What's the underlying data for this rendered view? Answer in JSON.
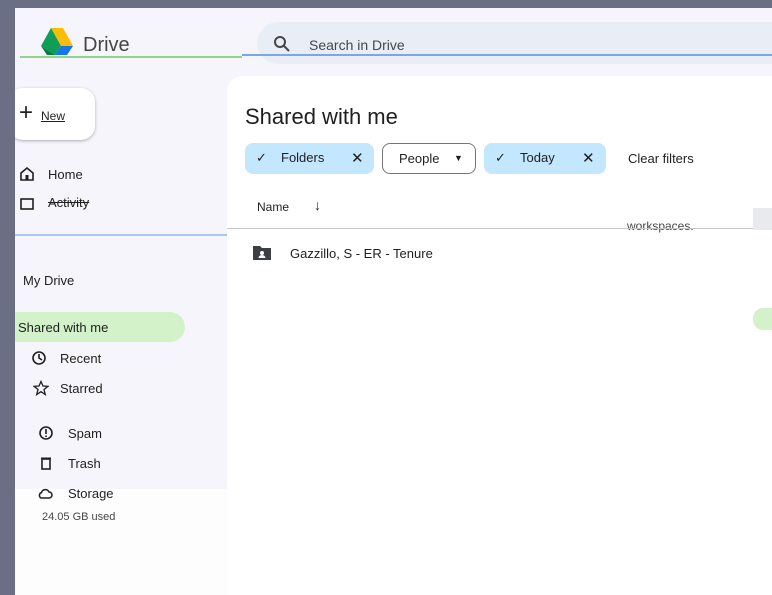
{
  "app": {
    "name": "Drive",
    "brand_color": "#1a73e8"
  },
  "search": {
    "placeholder": "Search in Drive"
  },
  "sidebar": {
    "new_label": "New",
    "items": [
      {
        "label": "Home",
        "icon": "home-icon"
      },
      {
        "label": "Activity",
        "icon": "activity-icon"
      },
      {
        "label": "My Drive",
        "icon": "my-drive-icon"
      },
      {
        "label": "Shared with me",
        "icon": "shared-icon",
        "active": true
      },
      {
        "label": "Recent",
        "icon": "clock-icon"
      },
      {
        "label": "Starred",
        "icon": "star-icon"
      },
      {
        "label": "Spam",
        "icon": "spam-icon"
      },
      {
        "label": "Trash",
        "icon": "trash-icon"
      },
      {
        "label": "Storage",
        "icon": "cloud-icon"
      }
    ],
    "storage_used": "24.05 GB used"
  },
  "main": {
    "title": "Shared with me",
    "filters": {
      "folders": "Folders",
      "people": "People",
      "today": "Today",
      "clear": "Clear filters"
    },
    "columns": {
      "name": "Name"
    },
    "workspaces_label": "workspaces.",
    "rows": [
      {
        "name": "Gazzillo, S - ER - Tenure",
        "icon": "shared-folder-icon"
      }
    ]
  },
  "colors": {
    "active_nav": "#d3f2c9",
    "chip_selected": "#c2e7ff",
    "background": "#f6f5fb"
  }
}
